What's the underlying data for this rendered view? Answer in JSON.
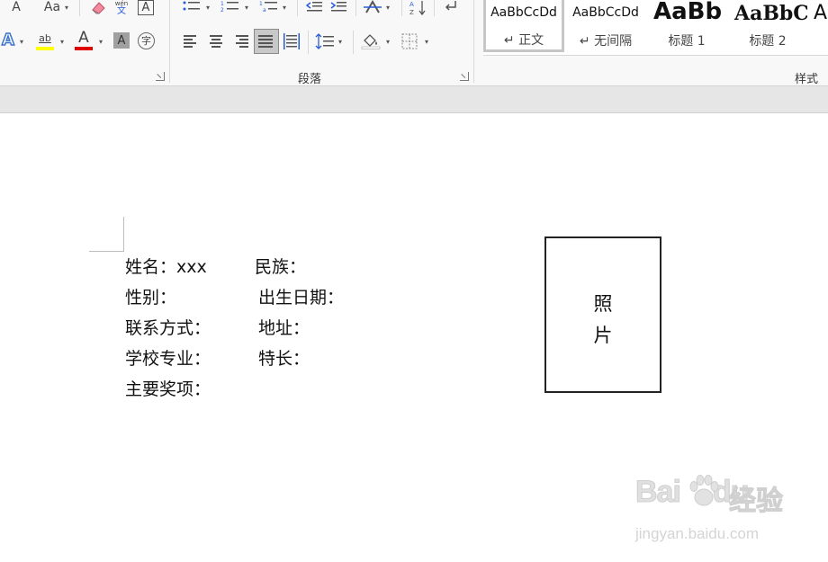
{
  "ribbon": {
    "font_group": {
      "change_case_label": "Aa",
      "font_size_letter": "A",
      "phonetic_top": "wén",
      "phonetic_bottom": "文",
      "char_border_letter": "A",
      "text_effects_letter": "A",
      "highlight_letters": "ab",
      "font_color_letter": "A",
      "char_shading_letter": "A",
      "enclose_char": "字",
      "highlight_color": "#ffff00",
      "font_color": "#e00000"
    },
    "paragraph_group": {
      "label": "段落"
    },
    "styles_group": {
      "label": "样式",
      "items": [
        {
          "preview": "AaBbCcDd",
          "name": "↵ 正文"
        },
        {
          "preview": "AaBbCcDd",
          "name": "↵ 无间隔"
        },
        {
          "preview": "AaBb",
          "name": "标题 1"
        },
        {
          "preview": "AaBbC",
          "name": "标题 2"
        },
        {
          "preview": "A",
          "name": ""
        }
      ]
    }
  },
  "document": {
    "rows": [
      {
        "left": "姓名：xxx",
        "right": "民族："
      },
      {
        "left": "性别：",
        "right": "出生日期："
      },
      {
        "left": "联系方式：",
        "right": "地址："
      },
      {
        "left": "学校专业：",
        "right": "特长："
      },
      {
        "left": "主要奖项：",
        "right": ""
      }
    ],
    "photo_box": {
      "line1": "照",
      "line2": "片"
    }
  },
  "watermark": {
    "logo_text": "Bai",
    "logo_text2": "du",
    "logo_cn": "经验",
    "url": "jingyan.baidu.com"
  }
}
